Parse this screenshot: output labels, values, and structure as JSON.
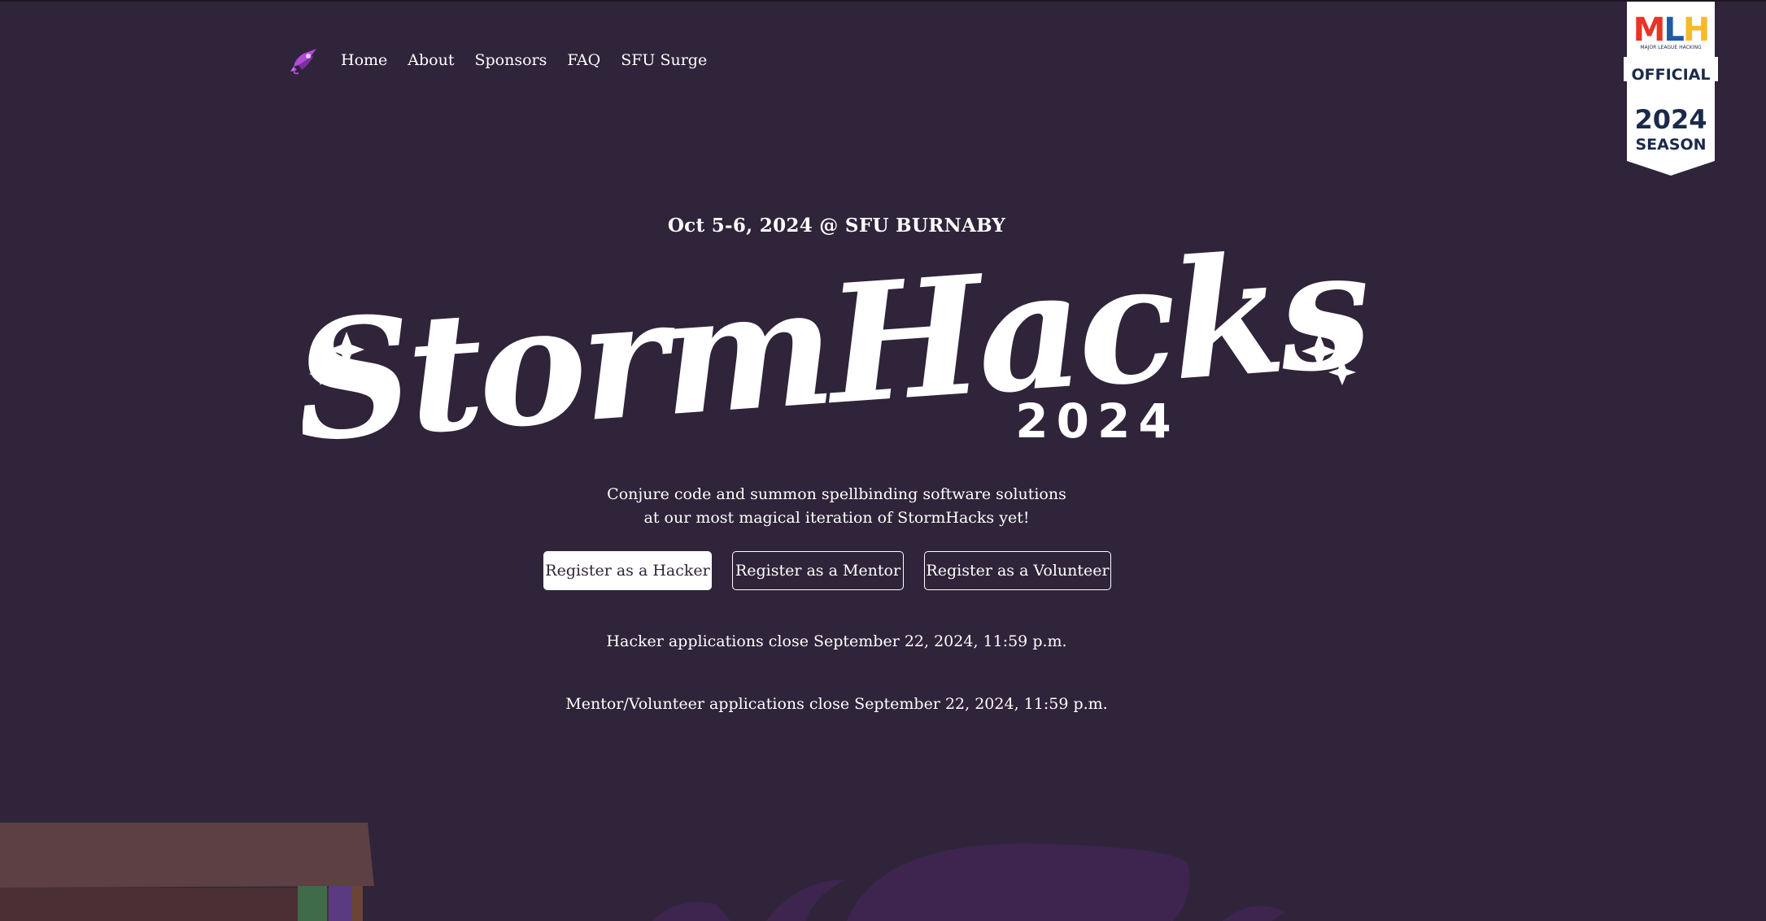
{
  "nav": {
    "logo_icon": "rocket-logo-icon",
    "items": [
      {
        "label": "Home"
      },
      {
        "label": "About"
      },
      {
        "label": "Sponsors"
      },
      {
        "label": "FAQ"
      },
      {
        "label": "SFU Surge"
      }
    ]
  },
  "mlh_badge": {
    "brand": "MLH",
    "subtitle": "MAJOR LEAGUE HACKING",
    "line1": "OFFICIAL",
    "line2": "2024",
    "line3": "SEASON",
    "colors": {
      "m": "#e73427",
      "l": "#1e5aa8",
      "h": "#f8b92a",
      "navy": "#1b2a4a"
    }
  },
  "hero": {
    "date": "Oct 5-6, 2024 @ SFU BURNABY",
    "title": "StormHacks",
    "year": "2024",
    "tagline": "Conjure code and summon spellbinding software solutions at our most magical iteration of StormHacks yet!"
  },
  "buttons": {
    "hacker": "Register as a Hacker",
    "mentor": "Register as a Mentor",
    "volunteer": "Register as a Volunteer"
  },
  "notes": {
    "hacker_close": "Hacker applications close September 22, 2024, 11:59 p.m.",
    "mentor_close": "Mentor/Volunteer applications close September 22, 2024, 11:59 p.m."
  },
  "colors": {
    "background": "#2f2439",
    "text": "#ffffff",
    "accent": "#b34ad8"
  }
}
